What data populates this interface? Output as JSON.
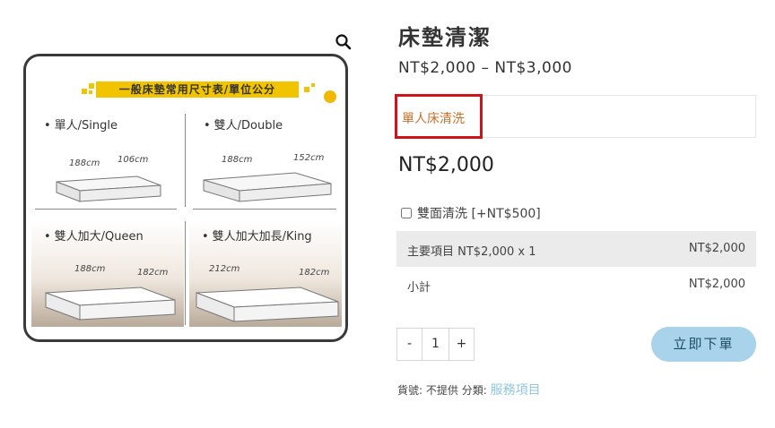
{
  "product": {
    "title": "床墊清潔",
    "price_range": "NT$2,000 – NT$3,000",
    "selected_variation": "單人床清洗",
    "price": "NT$2,000",
    "addon_label": "雙面清洗 [+NT$500]",
    "addon_checked": false
  },
  "summary": {
    "rows": [
      {
        "label": "主要項目 NT$2,000 x 1",
        "amount": "NT$2,000"
      },
      {
        "label": "小計",
        "amount": "NT$2,000"
      }
    ]
  },
  "cart": {
    "minus": "-",
    "quantity": "1",
    "plus": "+",
    "order_button": "立即下單"
  },
  "meta": {
    "sku_label": "貨號:",
    "sku_value": "不提供",
    "category_label": "分類:",
    "category_value": "服務項目"
  },
  "image": {
    "banner": "一般床墊常用尺寸表/單位公分",
    "panels": [
      {
        "label": "單人/Single",
        "length": "188cm",
        "width": "106cm"
      },
      {
        "label": "雙人/Double",
        "length": "188cm",
        "width": "152cm"
      },
      {
        "label": "雙人加大/Queen",
        "length": "188cm",
        "width": "182cm"
      },
      {
        "label": "雙人加大加長/King",
        "length": "212cm",
        "width": "182cm"
      }
    ]
  },
  "colors": {
    "accent_highlight": "#d0121b",
    "variation_text": "#c8702a",
    "button_bg": "#a8d3ea",
    "category_link": "#8fc6e0",
    "banner_yellow": "#f2c400"
  }
}
